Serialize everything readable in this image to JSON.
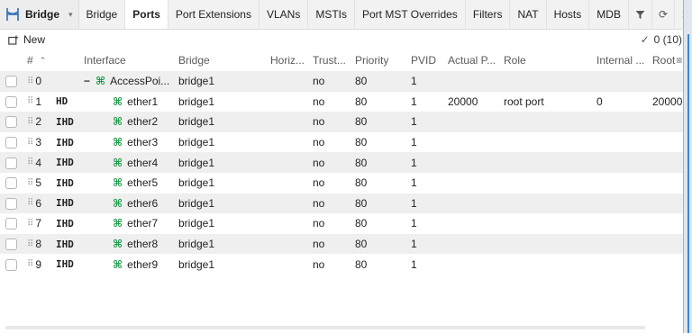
{
  "app": {
    "title": "Bridge"
  },
  "tabs": [
    {
      "label": "Bridge",
      "active": false
    },
    {
      "label": "Ports",
      "active": true
    },
    {
      "label": "Port Extensions",
      "active": false
    },
    {
      "label": "VLANs",
      "active": false
    },
    {
      "label": "MSTIs",
      "active": false
    },
    {
      "label": "Port MST Overrides",
      "active": false
    },
    {
      "label": "Filters",
      "active": false
    },
    {
      "label": "NAT",
      "active": false
    },
    {
      "label": "Hosts",
      "active": false
    },
    {
      "label": "MDB",
      "active": false
    }
  ],
  "toolbar": {
    "new_label": "New",
    "count": "0 (10)"
  },
  "columns": {
    "num": "#",
    "interface": "Interface",
    "bridge": "Bridge",
    "horizon": "Horiz...",
    "trusted": "Trust...",
    "priority": "Priority",
    "pvid": "PVID",
    "actual_path_cost": "Actual P...",
    "role": "Role",
    "internal": "Internal ...",
    "root": "Root"
  },
  "rows": [
    {
      "num": "0",
      "flags": "",
      "interface": "AccessPoi...",
      "bridge": "bridge1",
      "horizon": "",
      "trusted": "no",
      "priority": "80",
      "pvid": "1",
      "actual_path_cost": "",
      "role": "",
      "internal": "",
      "root": "",
      "is_parent": true
    },
    {
      "num": "1",
      "flags": "HD",
      "interface": "ether1",
      "bridge": "bridge1",
      "horizon": "",
      "trusted": "no",
      "priority": "80",
      "pvid": "1",
      "actual_path_cost": "20000",
      "role": "root port",
      "internal": "0",
      "root": "20000"
    },
    {
      "num": "2",
      "flags": "IHD",
      "interface": "ether2",
      "bridge": "bridge1",
      "horizon": "",
      "trusted": "no",
      "priority": "80",
      "pvid": "1",
      "actual_path_cost": "",
      "role": "",
      "internal": "",
      "root": ""
    },
    {
      "num": "3",
      "flags": "IHD",
      "interface": "ether3",
      "bridge": "bridge1",
      "horizon": "",
      "trusted": "no",
      "priority": "80",
      "pvid": "1",
      "actual_path_cost": "",
      "role": "",
      "internal": "",
      "root": ""
    },
    {
      "num": "4",
      "flags": "IHD",
      "interface": "ether4",
      "bridge": "bridge1",
      "horizon": "",
      "trusted": "no",
      "priority": "80",
      "pvid": "1",
      "actual_path_cost": "",
      "role": "",
      "internal": "",
      "root": ""
    },
    {
      "num": "5",
      "flags": "IHD",
      "interface": "ether5",
      "bridge": "bridge1",
      "horizon": "",
      "trusted": "no",
      "priority": "80",
      "pvid": "1",
      "actual_path_cost": "",
      "role": "",
      "internal": "",
      "root": ""
    },
    {
      "num": "6",
      "flags": "IHD",
      "interface": "ether6",
      "bridge": "bridge1",
      "horizon": "",
      "trusted": "no",
      "priority": "80",
      "pvid": "1",
      "actual_path_cost": "",
      "role": "",
      "internal": "",
      "root": ""
    },
    {
      "num": "7",
      "flags": "IHD",
      "interface": "ether7",
      "bridge": "bridge1",
      "horizon": "",
      "trusted": "no",
      "priority": "80",
      "pvid": "1",
      "actual_path_cost": "",
      "role": "",
      "internal": "",
      "root": ""
    },
    {
      "num": "8",
      "flags": "IHD",
      "interface": "ether8",
      "bridge": "bridge1",
      "horizon": "",
      "trusted": "no",
      "priority": "80",
      "pvid": "1",
      "actual_path_cost": "",
      "role": "",
      "internal": "",
      "root": ""
    },
    {
      "num": "9",
      "flags": "IHD",
      "interface": "ether9",
      "bridge": "bridge1",
      "horizon": "",
      "trusted": "no",
      "priority": "80",
      "pvid": "1",
      "actual_path_cost": "",
      "role": "",
      "internal": "",
      "root": ""
    }
  ],
  "icons": {
    "app": "bridge-icon",
    "port": "ethernet-port-icon",
    "filter": "filter-icon",
    "refresh": "refresh-icon",
    "close": "close-icon",
    "new": "new-item-icon",
    "sort": "sort-ascending-icon"
  },
  "colors": {
    "port_icon": "#1e9a4b",
    "active_tab_bg": "#ffffff",
    "alt_row_bg": "#efefef"
  }
}
